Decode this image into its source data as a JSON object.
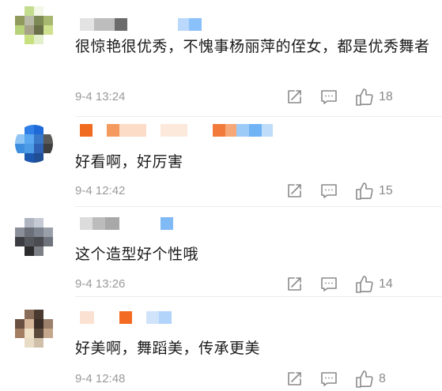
{
  "comments": [
    {
      "text": "很惊艳很优秀，不愧事杨丽萍的侄女，都是优秀舞者",
      "time": "9-4 13:24",
      "likes": "18"
    },
    {
      "text": "好看啊，好厉害",
      "time": "9-4 12:42",
      "likes": "15"
    },
    {
      "text": "这个造型好个性哦",
      "time": "9-4 13:26",
      "likes": "14"
    },
    {
      "text": "好美啊，舞蹈美，传承更美",
      "time": "9-4 12:48",
      "likes": "8"
    }
  ],
  "icons": {
    "share": "share-icon",
    "reply": "comment-icon",
    "like": "thumbs-up-icon"
  },
  "colors": {
    "text": "#1a1a1a",
    "meta": "#9a9a9a",
    "icon": "#8a8a8a"
  }
}
